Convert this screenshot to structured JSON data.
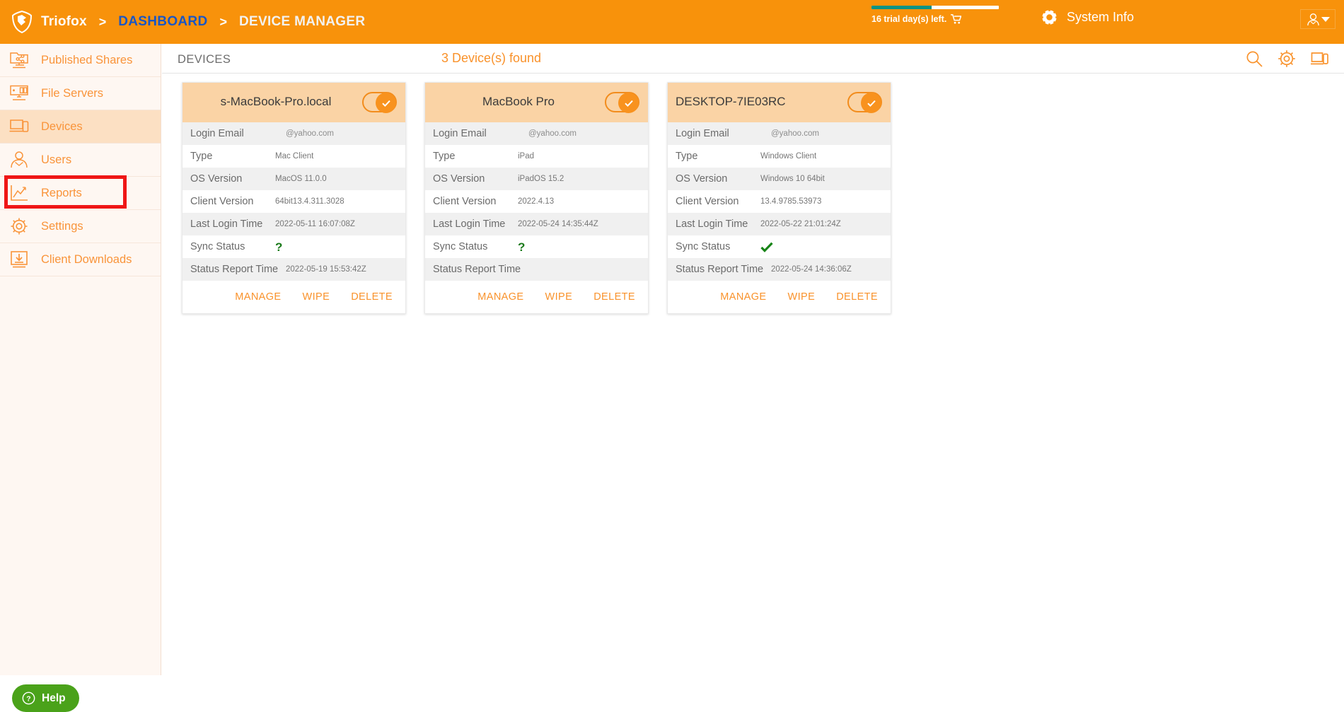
{
  "topbar": {
    "brand": "Triofox",
    "sep": ">",
    "crumb_dashboard": "DASHBOARD",
    "crumb_current": "DEVICE MANAGER",
    "trial_text": "16 trial day(s) left.",
    "trial_percent": 47,
    "system_info": "System Info",
    "accent": "#f8920b",
    "dashboard_link_color": "#1a56c4",
    "trial_bar_color": "#0a9383"
  },
  "sidebar": {
    "items": [
      {
        "label": "Published Shares",
        "icon": "published-shares-icon",
        "active": false
      },
      {
        "label": "File Servers",
        "icon": "file-servers-icon",
        "active": false
      },
      {
        "label": "Devices",
        "icon": "devices-icon",
        "active": true
      },
      {
        "label": "Users",
        "icon": "users-icon",
        "active": false
      },
      {
        "label": "Reports",
        "icon": "reports-icon",
        "active": false
      },
      {
        "label": "Settings",
        "icon": "settings-icon",
        "active": false
      },
      {
        "label": "Client Downloads",
        "icon": "client-downloads-icon",
        "active": false
      }
    ],
    "help_label": "Help",
    "help_color": "#4aa21a",
    "highlight_color": "#ef1616"
  },
  "main": {
    "page_title": "DEVICES",
    "found_count": "3 Device(s) found",
    "tools": [
      "search-icon",
      "gear-icon",
      "devices-view-icon"
    ],
    "row_labels": {
      "login_email": "Login Email",
      "type": "Type",
      "os_version": "OS Version",
      "client_version": "Client Version",
      "last_login_time": "Last Login Time",
      "sync_status": "Sync Status",
      "status_report_time": "Status Report Time"
    },
    "actions": {
      "manage": "MANAGE",
      "wipe": "WIPE",
      "delete": "DELETE"
    },
    "cards": [
      {
        "title": "s-MacBook-Pro.local",
        "title_align": "center",
        "enabled": true,
        "login_email": "@yahoo.com",
        "type": "Mac Client",
        "os_version": "MacOS 11.0.0",
        "client_version": "64bit13.4.311.3028",
        "last_login_time": "2022-05-11 16:07:08Z",
        "sync_status": "unknown",
        "sync_glyph": "?",
        "status_report_time": "2022-05-19 15:53:42Z"
      },
      {
        "title": "MacBook Pro",
        "title_align": "center",
        "enabled": true,
        "login_email": "@yahoo.com",
        "type": "iPad",
        "os_version": "iPadOS 15.2",
        "client_version": "2022.4.13",
        "last_login_time": "2022-05-24 14:35:44Z",
        "sync_status": "unknown",
        "sync_glyph": "?",
        "status_report_time": ""
      },
      {
        "title": "DESKTOP-7IE03RC",
        "title_align": "left",
        "enabled": true,
        "login_email": "@yahoo.com",
        "type": "Windows Client",
        "os_version": "Windows 10 64bit",
        "client_version": "13.4.9785.53973",
        "last_login_time": "2022-05-22 21:01:24Z",
        "sync_status": "ok",
        "sync_glyph": "✔",
        "status_report_time": "2022-05-24 14:36:06Z"
      }
    ]
  }
}
